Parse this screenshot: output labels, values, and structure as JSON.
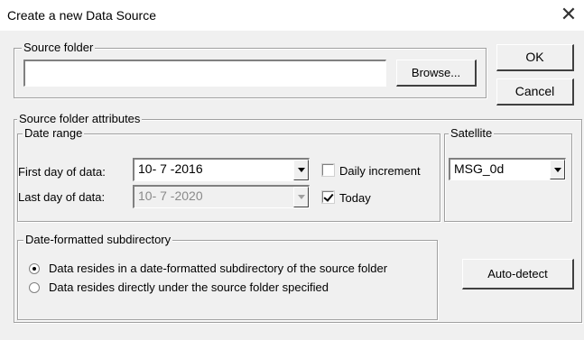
{
  "dialog": {
    "title": "Create a new Data Source",
    "close_label": "✕"
  },
  "source_folder": {
    "legend": "Source folder",
    "path_value": "",
    "browse_label": "Browse..."
  },
  "buttons": {
    "ok_label": "OK",
    "cancel_label": "Cancel",
    "auto_detect_label": "Auto-detect"
  },
  "attributes": {
    "legend": "Source folder attributes",
    "date_range": {
      "legend": "Date range",
      "first_day_label": "First day of data:",
      "first_day_value": "10- 7 -2016",
      "last_day_label": "Last day of data:",
      "last_day_value": "10- 7 -2020",
      "daily_increment_label": "Daily increment",
      "daily_increment_checked": false,
      "today_label": "Today",
      "today_checked": true
    },
    "satellite": {
      "legend": "Satellite",
      "selected": "MSG_0d"
    },
    "subdirectory": {
      "legend": "Date-formatted subdirectory",
      "option_1": "Data resides in a date-formatted subdirectory of the source folder",
      "option_2": "Data resides directly under the source folder specified",
      "selected_option": 1
    }
  }
}
